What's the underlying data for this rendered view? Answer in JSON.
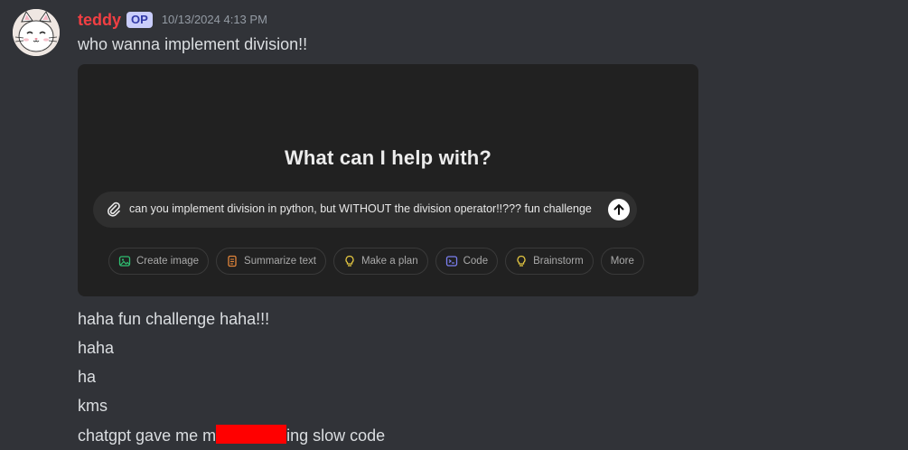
{
  "message": {
    "author": "teddy",
    "badge": "OP",
    "timestamp": "10/13/2024 4:13 PM",
    "lines": [
      "who wanna implement division!!",
      "haha fun challenge haha!!!",
      "haha",
      "ha",
      "kms"
    ],
    "last_line_prefix": "chatgpt gave me m",
    "last_line_suffix": "ing slow code",
    "colors": {
      "username": "#f23f43",
      "background": "#313338",
      "text": "#dbdee1",
      "redaction": "#ff0000"
    }
  },
  "embed": {
    "title": "What can I help with?",
    "prompt": "can you implement division in python, but WITHOUT the division operator!!??? fun challenge",
    "chips": [
      {
        "label": "Create image",
        "icon": "image-icon",
        "color": "#2fbf71"
      },
      {
        "label": "Summarize text",
        "icon": "document-icon",
        "color": "#e0843a"
      },
      {
        "label": "Make a plan",
        "icon": "lightbulb-icon",
        "color": "#e2c541"
      },
      {
        "label": "Code",
        "icon": "terminal-icon",
        "color": "#7b7ff0"
      },
      {
        "label": "Brainstorm",
        "icon": "lightbulb-icon",
        "color": "#e2c541"
      },
      {
        "label": "More",
        "icon": "",
        "color": ""
      }
    ]
  }
}
